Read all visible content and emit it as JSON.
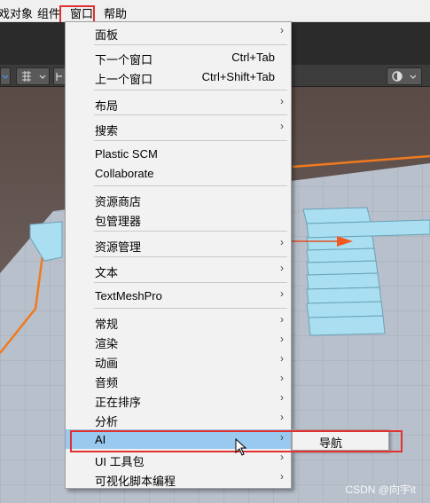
{
  "menubar": {
    "items": [
      {
        "label": "戏对象"
      },
      {
        "label": "组件"
      },
      {
        "label": "窗口"
      },
      {
        "label": "帮助"
      }
    ]
  },
  "menu": {
    "items": [
      {
        "label": "面板",
        "shortcut": "",
        "has_submenu": true
      },
      {
        "label": "下一个窗口",
        "shortcut": "Ctrl+Tab",
        "has_submenu": false
      },
      {
        "label": "上一个窗口",
        "shortcut": "Ctrl+Shift+Tab",
        "has_submenu": false
      },
      {
        "label": "布局",
        "shortcut": "",
        "has_submenu": true
      },
      {
        "label": "搜索",
        "shortcut": "",
        "has_submenu": true
      },
      {
        "label": "Plastic SCM",
        "shortcut": "",
        "has_submenu": false
      },
      {
        "label": "Collaborate",
        "shortcut": "",
        "has_submenu": false
      },
      {
        "label": "资源商店",
        "shortcut": "",
        "has_submenu": false
      },
      {
        "label": "包管理器",
        "shortcut": "",
        "has_submenu": false
      },
      {
        "label": "资源管理",
        "shortcut": "",
        "has_submenu": true
      },
      {
        "label": "文本",
        "shortcut": "",
        "has_submenu": true
      },
      {
        "label": "TextMeshPro",
        "shortcut": "",
        "has_submenu": true
      },
      {
        "label": "常规",
        "shortcut": "",
        "has_submenu": true
      },
      {
        "label": "渲染",
        "shortcut": "",
        "has_submenu": true
      },
      {
        "label": "动画",
        "shortcut": "",
        "has_submenu": true
      },
      {
        "label": "音频",
        "shortcut": "",
        "has_submenu": true
      },
      {
        "label": "正在排序",
        "shortcut": "",
        "has_submenu": true
      },
      {
        "label": "分析",
        "shortcut": "",
        "has_submenu": true
      },
      {
        "label": "AI",
        "shortcut": "",
        "has_submenu": true,
        "active": true
      },
      {
        "label": "UI 工具包",
        "shortcut": "",
        "has_submenu": true
      },
      {
        "label": "可视化脚本编程",
        "shortcut": "",
        "has_submenu": true
      }
    ],
    "arrow_glyph": "›"
  },
  "submenu": {
    "items": [
      {
        "label": "导航"
      }
    ]
  },
  "watermark": "CSDN @向宇it",
  "colors": {
    "highlight_box": "#e03030",
    "active_row": "#99c9ef",
    "scene_floor": "#b8c0cc",
    "stairs": "#a9dff0",
    "selection_outline": "#f07a1e"
  },
  "icons": {
    "toolbar": [
      "view-dropdown-icon",
      "grid-icon",
      "snap-icon",
      "gizmo-toggle-icon"
    ],
    "scene": [
      "orange-cone-gizmo-icon"
    ],
    "cursor": "mouse-cursor-icon"
  }
}
